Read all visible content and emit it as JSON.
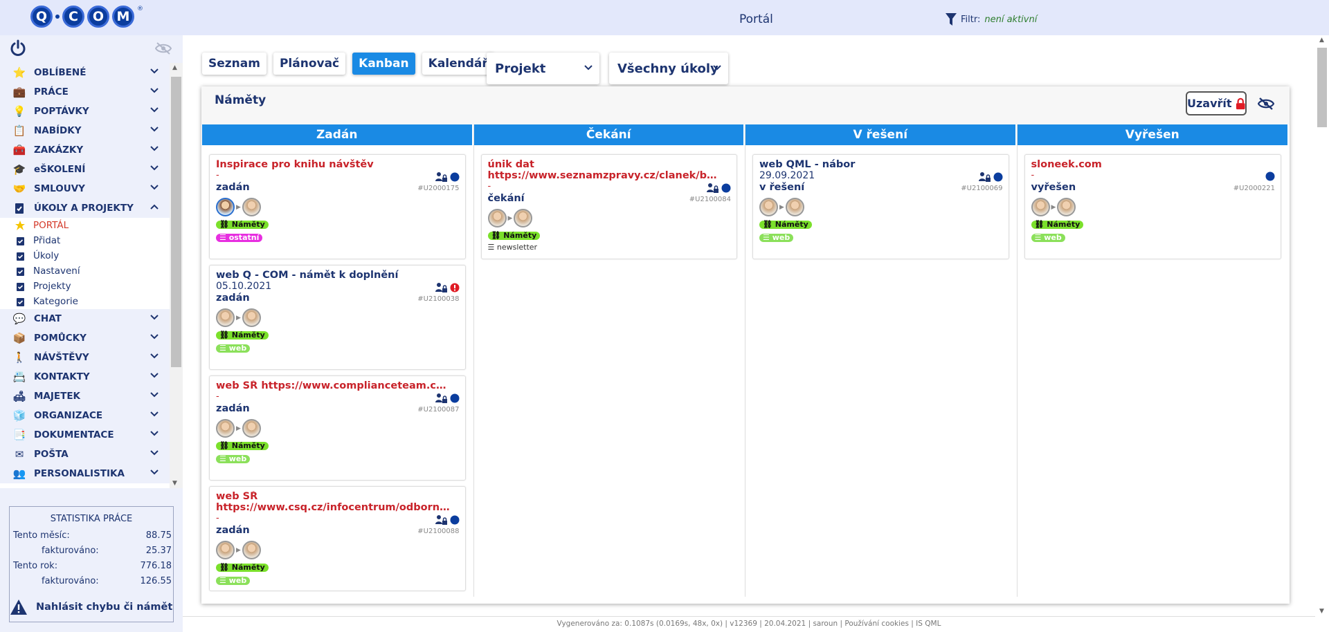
{
  "header": {
    "logo_text": "Q·COM",
    "logo_letters": [
      "Q",
      "C",
      "O",
      "M"
    ],
    "logo_registered": "®",
    "title": "Portál",
    "filter_label": "Filtr:",
    "filter_state": "není aktivní"
  },
  "sidebar": {
    "menu": [
      {
        "label": "OBLÍBENÉ",
        "icon": "star-icon",
        "expanded": false
      },
      {
        "label": "PRÁCE",
        "icon": "briefcase-icon",
        "expanded": false
      },
      {
        "label": "POPTÁVKY",
        "icon": "lightbulb-icon",
        "expanded": false
      },
      {
        "label": "NABÍDKY",
        "icon": "clipboard-icon",
        "expanded": false
      },
      {
        "label": "ZAKÁZKY",
        "icon": "toolbox-icon",
        "expanded": false
      },
      {
        "label": "eŠKOLENÍ",
        "icon": "graduation-cap-icon",
        "expanded": false
      },
      {
        "label": "SMLOUVY",
        "icon": "handshake-icon",
        "expanded": false
      },
      {
        "label": "ÚKOLY A PROJEKTY",
        "icon": "task-icon",
        "expanded": true
      }
    ],
    "submenu": [
      {
        "label": "PORTÁL",
        "icon": "star-icon",
        "active": true
      },
      {
        "label": "Přidat",
        "icon": "checkbox-icon"
      },
      {
        "label": "Úkoly",
        "icon": "checkbox-icon"
      },
      {
        "label": "Nastavení",
        "icon": "checkbox-icon"
      },
      {
        "label": "Projekty",
        "icon": "checkbox-icon"
      },
      {
        "label": "Kategorie",
        "icon": "checkbox-icon"
      }
    ],
    "menu2": [
      {
        "label": "CHAT",
        "icon": "chat-icon"
      },
      {
        "label": "POMŮCKY",
        "icon": "box-icon"
      },
      {
        "label": "NÁVŠTĚVY",
        "icon": "walking-person-icon"
      },
      {
        "label": "KONTAKTY",
        "icon": "contact-card-icon"
      },
      {
        "label": "MAJETEK",
        "icon": "armchair-icon"
      },
      {
        "label": "ORGANIZACE",
        "icon": "cubes-icon"
      },
      {
        "label": "DOKUMENTACE",
        "icon": "documents-icon"
      },
      {
        "label": "POŠTA",
        "icon": "envelope-icon"
      },
      {
        "label": "PERSONALISTIKA",
        "icon": "people-icon"
      }
    ],
    "stats": {
      "title": "STATISTIKA PRÁCE",
      "month_label": "Tento měsíc:",
      "month_value": "88.75",
      "month_billed_label": "fakturováno:",
      "month_billed_value": "25.37",
      "year_label": "Tento rok:",
      "year_value": "776.18",
      "year_billed_label": "fakturováno:",
      "year_billed_value": "126.55"
    },
    "report_label": "Nahlásit chybu či námět"
  },
  "toolbar": {
    "tabs": [
      {
        "label": "Seznam"
      },
      {
        "label": "Plánovač"
      },
      {
        "label": "Kanban",
        "active": true
      },
      {
        "label": "Kalendář"
      }
    ],
    "project_select": "Projekt",
    "tasks_select": "Všechny úkoly"
  },
  "board": {
    "title": "Náměty",
    "close_label": "Uzavřít",
    "columns": [
      {
        "title": "Zadán",
        "cards": [
          {
            "title": "Inspirace pro knihu návštěv",
            "sub": "-",
            "status": "zadán",
            "id": "#U2000175",
            "title_color": "red",
            "indicator": "dot",
            "avatar_blue": true,
            "tag": "Náměty",
            "tag2": "ostatní",
            "tag2_type": "m"
          },
          {
            "title": "web Q - COM - námět k doplnění",
            "sub": "05.10.2021",
            "status": "zadán",
            "id": "#U2100038",
            "title_color": "blue",
            "indicator": "alert",
            "tag": "Náměty",
            "tag2": "web",
            "tag2_type": "lg"
          },
          {
            "title": "web SŘ https://www.complianceteam.cz/kvalitni...",
            "sub": "-",
            "status": "zadán",
            "id": "#U2100087",
            "title_color": "red",
            "indicator": "dot",
            "tag": "Náměty",
            "tag2": "web",
            "tag2_type": "lg"
          },
          {
            "title": "web SŘ",
            "title2": "https://www.csq.cz/infocentrum/odborne...",
            "sub": "-",
            "status": "zadán",
            "id": "#U2100088",
            "title_color": "red",
            "indicator": "dot",
            "tag": "Náměty",
            "tag2": "web",
            "tag2_type": "lg"
          }
        ]
      },
      {
        "title": "Čekání",
        "cards": [
          {
            "title": "únik dat",
            "title2": "https://www.seznamzpravy.cz/clanek/bomby...",
            "sub": "-",
            "status": "čekání",
            "id": "#U2100084",
            "title_color": "red",
            "indicator": "dot",
            "tag": "Náměty",
            "tag2": "newsletter",
            "tag2_type": "plain"
          }
        ]
      },
      {
        "title": "V řešení",
        "cards": [
          {
            "title": "web QML - nábor",
            "sub": "29.09.2021",
            "status": "v řešení",
            "id": "#U2100069",
            "title_color": "blue",
            "indicator": "dot",
            "tag": "Náměty",
            "tag2": "web",
            "tag2_type": "lg"
          }
        ]
      },
      {
        "title": "Vyřešen",
        "cards": [
          {
            "title": "sloneek.com",
            "sub": "-",
            "status": "vyřešen",
            "id": "#U2000221",
            "title_color": "red",
            "indicator": "dot_only",
            "tag": "Náměty",
            "tag2": "web",
            "tag2_type": "lg"
          }
        ]
      }
    ]
  },
  "footer": "Vygenerováno za: 0.1087s (0.0169s, 48x, 0x) | v12369 | 20.04.2021 | saroun | Používání cookies | IS QML",
  "colors": {
    "accent": "#1a8ae4",
    "navy": "#1d3470",
    "red": "#c8232a",
    "topbar": "#e3e8fb",
    "tag_green": "#7be02b"
  }
}
